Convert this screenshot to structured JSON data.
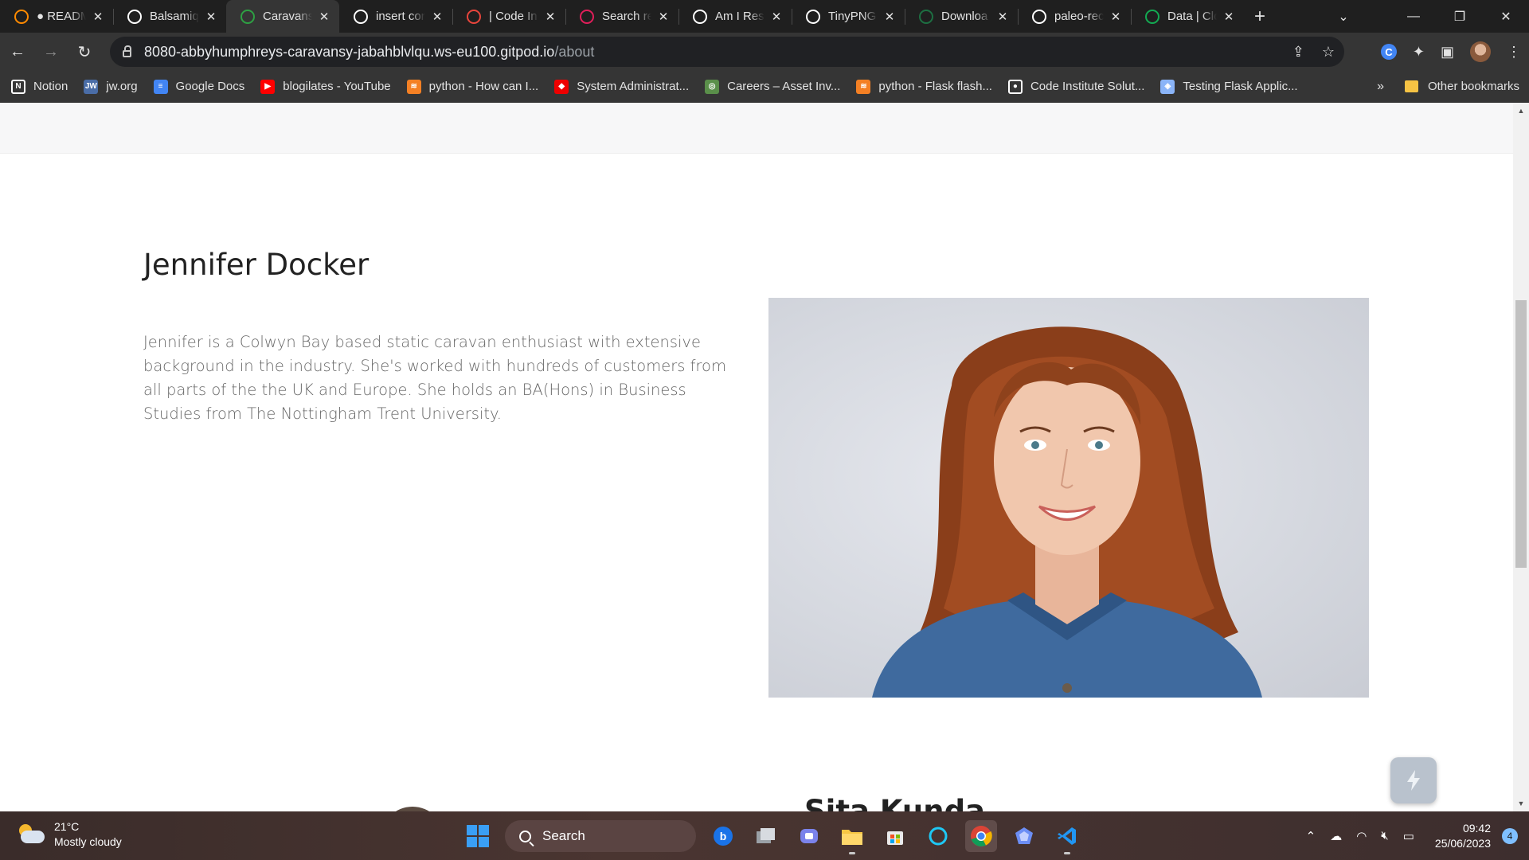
{
  "browser": {
    "tabs": [
      {
        "title": "● READM",
        "favicon": "gitpod-icon",
        "color": "#ff8a00"
      },
      {
        "title": "Balsamiq",
        "favicon": "balsamiq-icon",
        "color": "#ffffff"
      },
      {
        "title": "Caravansy",
        "favicon": "caravansy-icon",
        "color": "#2ea043"
      },
      {
        "title": "insert cor",
        "favicon": "google-icon",
        "color": "#ffffff"
      },
      {
        "title": "| Code In",
        "favicon": "code-institute-icon",
        "color": "#e8453c"
      },
      {
        "title": "Search re",
        "favicon": "slack-icon",
        "color": "#e01e5a"
      },
      {
        "title": "Am I Resp",
        "favicon": "amiresponsive-icon",
        "color": "#ffffff"
      },
      {
        "title": "TinyPNG",
        "favicon": "tinypng-icon",
        "color": "#ffffff"
      },
      {
        "title": "Downloa",
        "favicon": "excel-icon",
        "color": "#1d6f42"
      },
      {
        "title": "paleo-rec",
        "favicon": "github-icon",
        "color": "#ffffff"
      },
      {
        "title": "Data | Clo",
        "favicon": "mongodb-icon",
        "color": "#13aa52"
      }
    ],
    "active_tab_index": 2,
    "url_host": "8080-abbyhumphreys-caravansy-jabahblvlqu.ws-eu100.gitpod.io",
    "url_path": "/about",
    "bookmarks": [
      {
        "label": "Notion",
        "icon": "notion-icon",
        "color": "#ffffff",
        "glyph": "N"
      },
      {
        "label": "jw.org",
        "icon": "jw-icon",
        "color": "#4a6da7",
        "glyph": "JW"
      },
      {
        "label": "Google Docs",
        "icon": "google-docs-icon",
        "color": "#4285f4",
        "glyph": "≡"
      },
      {
        "label": "blogilates - YouTube",
        "icon": "youtube-icon",
        "color": "#ff0000",
        "glyph": "▶"
      },
      {
        "label": "python - How can I...",
        "icon": "stackoverflow-icon",
        "color": "#f48024",
        "glyph": "≋"
      },
      {
        "label": "System Administrat...",
        "icon": "redhat-icon",
        "color": "#ee0000",
        "glyph": "◆"
      },
      {
        "label": "Careers – Asset Inv...",
        "icon": "careers-icon",
        "color": "#5a8f4a",
        "glyph": "◎"
      },
      {
        "label": "python - Flask flash...",
        "icon": "stackoverflow-icon",
        "color": "#f48024",
        "glyph": "≋"
      },
      {
        "label": "Code Institute Solut...",
        "icon": "github-icon",
        "color": "#ffffff",
        "glyph": "●"
      },
      {
        "label": "Testing Flask Applic...",
        "icon": "flask-cube-icon",
        "color": "#8ab4f8",
        "glyph": "◈"
      }
    ],
    "more_bookmarks": "»",
    "other_bookmarks": "Other bookmarks"
  },
  "page": {
    "person": {
      "name": "Jennifer Docker",
      "bio": "Jennifer is a Colwyn Bay based static caravan enthusiast with extensive background in the industry. She's worked with hundreds of customers from all parts of the the UK and Europe. She holds an BA(Hons) in Business Studies from The Nottingham Trent University."
    },
    "next_person_name": "Sita Kunda"
  },
  "taskbar": {
    "temperature": "21°C",
    "weather": "Mostly cloudy",
    "search_label": "Search",
    "time": "09:42",
    "date": "25/06/2023",
    "notifications": "4"
  },
  "colors": {
    "accent": "#7fbfff",
    "heading": "#222222",
    "body_text": "#666666"
  }
}
